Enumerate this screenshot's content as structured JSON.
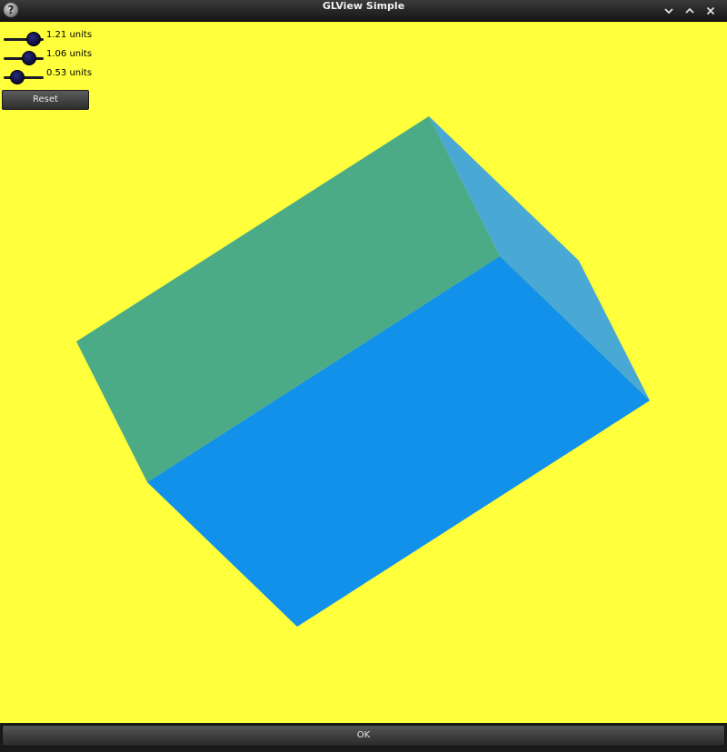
{
  "window": {
    "title": "GLView Simple",
    "help_icon_glyph": "?",
    "controls": [
      "chevron-down-icon",
      "chevron-up-icon",
      "close-icon"
    ]
  },
  "viewport": {
    "background_color": "#ffff3c",
    "cube_colors": {
      "top_face": "#4cab87",
      "front_face": "#1291eb",
      "side_face": "#49a9d4"
    }
  },
  "sliders": [
    {
      "value_label": "1.21 units",
      "level": 0.75
    },
    {
      "value_label": "1.06 units",
      "level": 0.63
    },
    {
      "value_label": "0.53 units",
      "level": 0.35
    }
  ],
  "reset_button": {
    "label": "Reset"
  },
  "ok_button": {
    "label": "OK"
  }
}
